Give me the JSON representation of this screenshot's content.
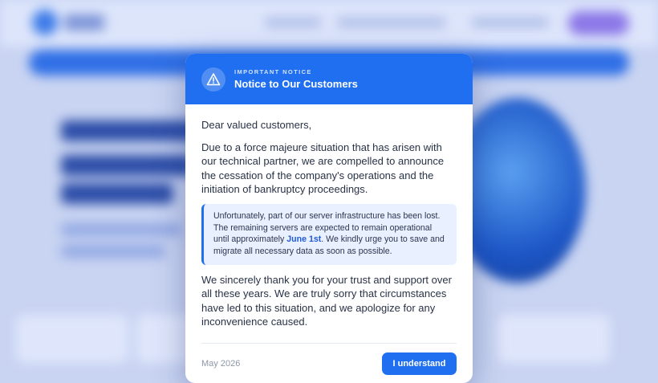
{
  "notice": {
    "eyebrow": "IMPORTANT NOTICE",
    "title": "Notice to Our Customers",
    "greeting": "Dear valued customers,",
    "paragraph1": "Due to a force majeure situation that has arisen with our technical partner, we are compelled to announce the cessation of the company's operations and the initiation of bankruptcy proceedings.",
    "callout_before": "Unfortunately, part of our server infrastructure has been lost. The remaining servers are expected to remain operational until approximately ",
    "callout_highlight": "June 1st",
    "callout_after": ". We kindly urge you to save and migrate all necessary data as soon as possible.",
    "paragraph2": "We sincerely thank you for your trust and support over all these years. We are truly sorry that circumstances have led to this situation, and we apologize for any inconvenience caused.",
    "date": "May 2026",
    "button_label": "I understand",
    "icon": "warning-triangle-icon"
  },
  "colors": {
    "accent": "#1f6ff0",
    "callout_bg": "#e9f0ff"
  }
}
